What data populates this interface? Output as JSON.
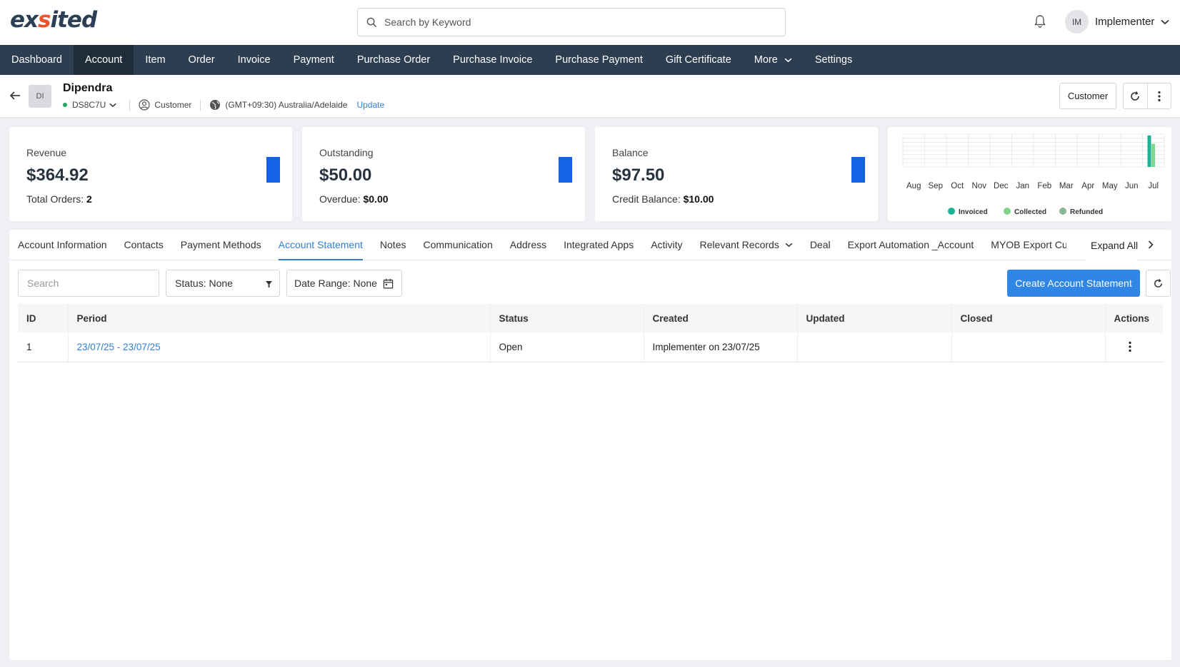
{
  "brand": {
    "logo_pre": "ex",
    "logo_accent": "s",
    "logo_post": "ited"
  },
  "header": {
    "search_placeholder": "Search by Keyword",
    "user_initials": "IM",
    "user_name": "Implementer"
  },
  "nav": {
    "items": [
      "Dashboard",
      "Account",
      "Item",
      "Order",
      "Invoice",
      "Payment",
      "Purchase Order",
      "Purchase Invoice",
      "Purchase Payment",
      "Gift Certificate",
      "More",
      "Settings"
    ],
    "active": "Account"
  },
  "account": {
    "initials": "DI",
    "name": "Dipendra",
    "code": "DS8C7U",
    "type": "Customer",
    "timezone": "(GMT+09:30) Australia/Adelaide",
    "update_link": "Update",
    "role_button": "Customer"
  },
  "stats": {
    "revenue": {
      "label": "Revenue",
      "value": "$364.92",
      "sub_label": "Total Orders:",
      "sub_value": "2"
    },
    "outstanding": {
      "label": "Outstanding",
      "value": "$50.00",
      "sub_label": "Overdue:",
      "sub_value": "$0.00"
    },
    "balance": {
      "label": "Balance",
      "value": "$97.50",
      "sub_label": "Credit Balance:",
      "sub_value": "$10.00"
    }
  },
  "chart_data": {
    "type": "bar",
    "categories": [
      "Aug",
      "Sep",
      "Oct",
      "Nov",
      "Dec",
      "Jan",
      "Feb",
      "Mar",
      "Apr",
      "May",
      "Jun",
      "Jul"
    ],
    "series": [
      {
        "name": "Invoiced",
        "color": "#1bb394",
        "values": [
          0,
          0,
          0,
          0,
          0,
          0,
          0,
          0,
          0,
          0,
          0,
          364.92
        ]
      },
      {
        "name": "Collected",
        "color": "#7fd68f",
        "values": [
          0,
          0,
          0,
          0,
          0,
          0,
          0,
          0,
          0,
          0,
          0,
          267.42
        ]
      },
      {
        "name": "Refunded",
        "color": "#8fb89a",
        "values": [
          0,
          0,
          0,
          0,
          0,
          0,
          0,
          0,
          0,
          0,
          0,
          0
        ]
      }
    ],
    "ylim": [
      0,
      380
    ],
    "grid": true,
    "legend": "bottom"
  },
  "tabs": {
    "items": [
      "Account Information",
      "Contacts",
      "Payment Methods",
      "Account Statement",
      "Notes",
      "Communication",
      "Address",
      "Integrated Apps",
      "Activity",
      "Relevant Records",
      "Deal",
      "Export Automation _Account",
      "MYOB Export Cus"
    ],
    "active": "Account Statement",
    "expand_all": "Expand All"
  },
  "toolbar": {
    "search_placeholder": "Search",
    "status_filter": "Status: None",
    "date_filter": "Date Range: None",
    "create_button": "Create Account Statement"
  },
  "table": {
    "columns": [
      "ID",
      "Period",
      "Status",
      "Created",
      "Updated",
      "Closed",
      "Actions"
    ],
    "rows": [
      {
        "id": "1",
        "period": "23/07/25 - 23/07/25",
        "status": "Open",
        "created": "Implementer on 23/07/25",
        "updated": "",
        "closed": ""
      }
    ]
  }
}
